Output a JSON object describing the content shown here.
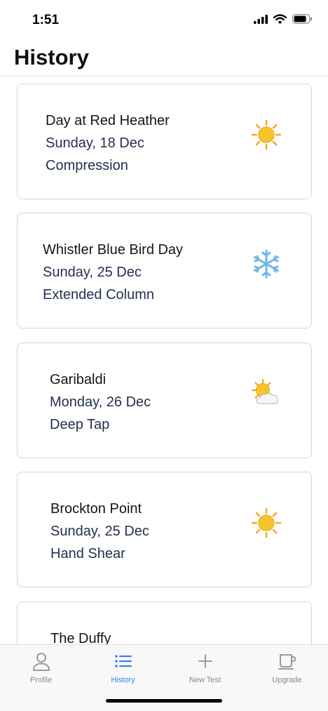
{
  "status_bar": {
    "time": "1:51",
    "icons": [
      "cellular-signal-icon",
      "wifi-icon",
      "battery-icon"
    ]
  },
  "page": {
    "title": "History"
  },
  "history": [
    {
      "name": "Day at Red Heather",
      "date": "Sunday, 18 Dec",
      "test": "Compression",
      "weather_icon": "sunny-icon"
    },
    {
      "name": "Whistler Blue Bird Day",
      "date": "Sunday, 25 Dec",
      "test": "Extended Column",
      "weather_icon": "snowflake-icon"
    },
    {
      "name": "Garibaldi",
      "date": "Monday, 26 Dec",
      "test": "Deep Tap",
      "weather_icon": "partly-cloudy-icon"
    },
    {
      "name": "Brockton Point",
      "date": "Sunday, 25 Dec",
      "test": "Hand Shear",
      "weather_icon": "sunny-icon"
    },
    {
      "name": "The Duffy",
      "date": "",
      "test": "",
      "weather_icon": "weather-icon"
    }
  ],
  "tabbar": {
    "tabs": [
      {
        "label": "Profile",
        "icon": "person-icon",
        "active": false
      },
      {
        "label": "History",
        "icon": "list-icon",
        "active": true
      },
      {
        "label": "New Test",
        "icon": "plus-icon",
        "active": false
      },
      {
        "label": "Upgrade",
        "icon": "cup-icon",
        "active": false
      }
    ]
  },
  "colors": {
    "accent": "#3b82e6",
    "card_border": "#d6d6d9",
    "detail_text": "#233050",
    "tab_inactive": "#888888"
  }
}
